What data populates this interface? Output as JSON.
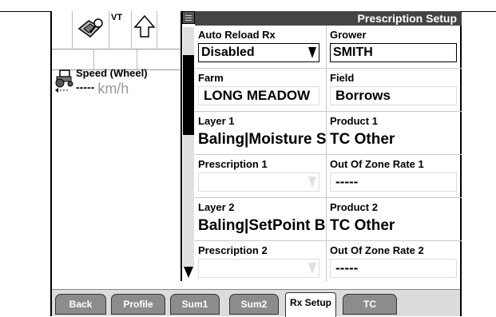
{
  "header": {
    "title": "Prescription Setup"
  },
  "status": {
    "vt_label": "VT",
    "speed_label": "Speed (Wheel)",
    "speed_value": "-----",
    "speed_unit": "km/h"
  },
  "fields": {
    "auto_reload": {
      "label": "Auto Reload Rx",
      "value": "Disabled"
    },
    "grower": {
      "label": "Grower",
      "value": "SMITH"
    },
    "farm": {
      "label": "Farm",
      "value": "LONG MEADOW"
    },
    "field": {
      "label": "Field",
      "value": "Borrows"
    },
    "layer1": {
      "label": "Layer 1",
      "value": "Baling|Moisture S"
    },
    "product1": {
      "label": "Product 1",
      "value": "TC Other"
    },
    "prescription1": {
      "label": "Prescription 1",
      "value": ""
    },
    "out_of_zone1": {
      "label": "Out Of Zone Rate 1",
      "value": "-----"
    },
    "layer2": {
      "label": "Layer 2",
      "value": "Baling|SetPoint B"
    },
    "product2": {
      "label": "Product 2",
      "value": "TC Other"
    },
    "prescription2": {
      "label": "Prescription 2",
      "value": ""
    },
    "out_of_zone2": {
      "label": "Out Of Zone Rate 2",
      "value": "-----"
    }
  },
  "tabs": [
    "Back",
    "Profile",
    "Sum1",
    "Sum2",
    "Rx Setup",
    "TC"
  ],
  "active_tab": "Rx Setup"
}
